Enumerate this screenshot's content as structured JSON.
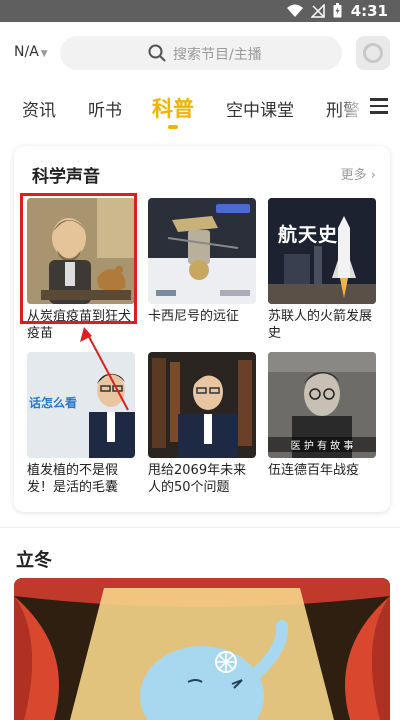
{
  "status_bar": {
    "time": "4:31"
  },
  "header": {
    "region": "N/A",
    "search_placeholder": "搜索节目/主播"
  },
  "tabs": [
    {
      "label": "资讯"
    },
    {
      "label": "听书"
    },
    {
      "label": "科普"
    },
    {
      "label": "空中课堂"
    },
    {
      "label": "刑警"
    }
  ],
  "section": {
    "title": "科学声音",
    "more": "更多",
    "items": [
      {
        "title": "从炭疽疫苗到狂犬疫苗"
      },
      {
        "title": "卡西尼号的远征"
      },
      {
        "title": "苏联人的火箭发展史",
        "thumb_text": "航天史"
      },
      {
        "title": "植发植的不是假发！是活的毛囊",
        "thumb_text": "话怎么看"
      },
      {
        "title": "甩给2069年未来人的50个问题"
      },
      {
        "title": "伍连德百年战疫",
        "thumb_text": "医 护 有 故 事"
      }
    ]
  },
  "section2": {
    "title": "立冬"
  },
  "colors": {
    "accent": "#f0b400",
    "highlight": "#d9201f"
  }
}
